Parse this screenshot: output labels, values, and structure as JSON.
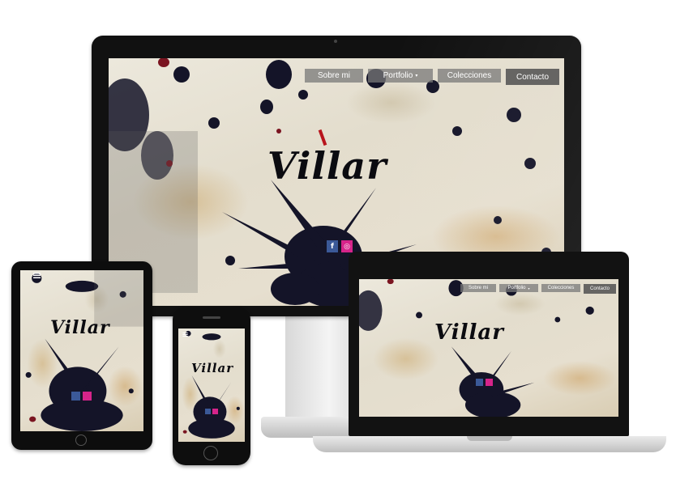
{
  "desktop": {
    "nav": [
      {
        "label": "Sobre mi"
      },
      {
        "label": "Portfolio",
        "caret": "▾"
      },
      {
        "label": "Colecciones"
      },
      {
        "label": "Contacto"
      }
    ],
    "logo": "Villar",
    "social": {
      "facebook_glyph": "f",
      "instagram_glyph": "◎"
    }
  },
  "laptop": {
    "nav": [
      {
        "label": "Sobre mi"
      },
      {
        "label": "Portfolio",
        "caret": "▾"
      },
      {
        "label": "Colecciones"
      },
      {
        "label": "Contacto"
      }
    ],
    "logo": "Villar"
  },
  "tablet": {
    "logo": "Villar"
  },
  "phone": {
    "logo": "Villar"
  },
  "colors": {
    "facebook": "#3b5998",
    "instagram": "#d6248a",
    "accent_red": "#b8141c",
    "ink": "#0b0b10"
  }
}
